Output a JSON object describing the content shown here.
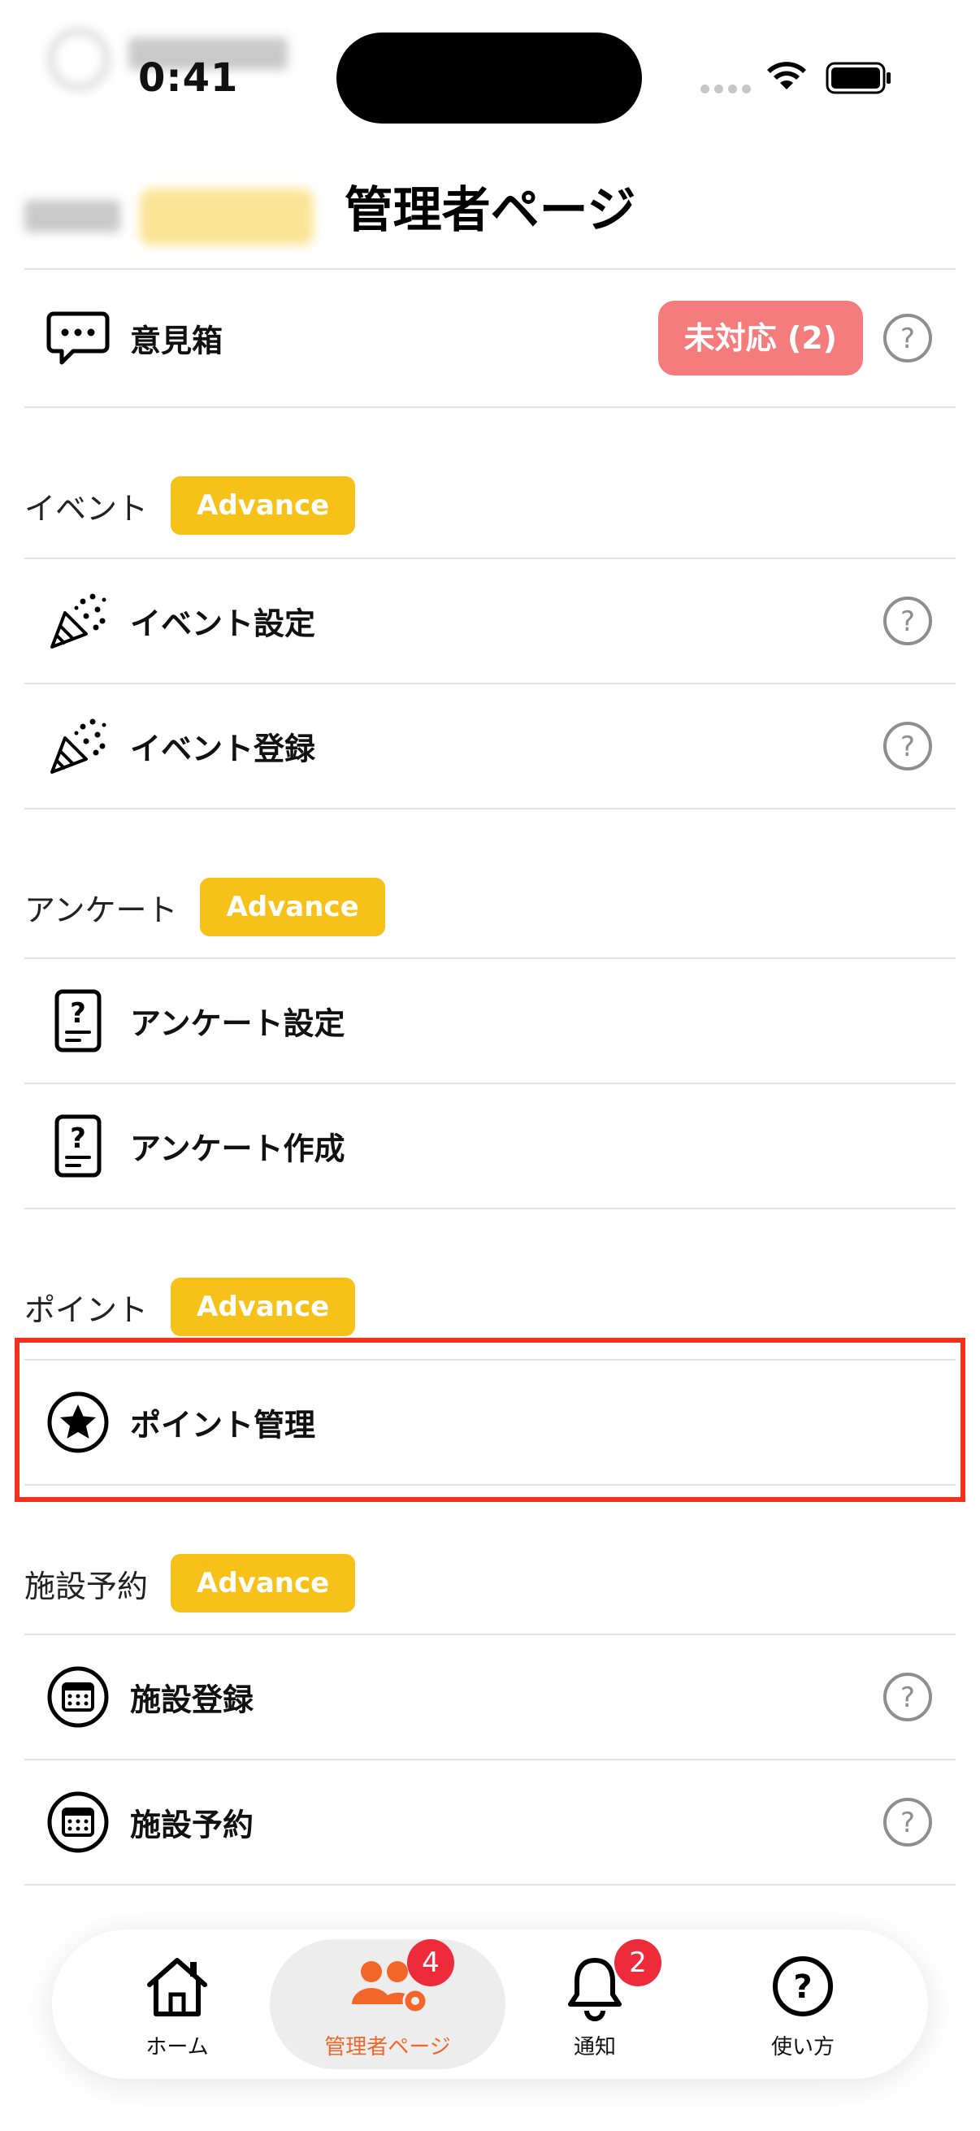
{
  "status_bar": {
    "time": "0:41"
  },
  "header": {
    "title": "管理者ページ"
  },
  "feedback_row": {
    "label": "意見箱",
    "status": "未対応 (2)"
  },
  "sections": [
    {
      "title": "イベント",
      "badge": "Advance",
      "items": [
        {
          "label": "イベント設定",
          "icon": "party-popper-icon",
          "has_help": true
        },
        {
          "label": "イベント登録",
          "icon": "party-popper-icon",
          "has_help": true
        }
      ]
    },
    {
      "title": "アンケート",
      "badge": "Advance",
      "items": [
        {
          "label": "アンケート設定",
          "icon": "survey-document-icon",
          "has_help": false
        },
        {
          "label": "アンケート作成",
          "icon": "survey-document-icon",
          "has_help": false
        }
      ]
    },
    {
      "title": "ポイント",
      "badge": "Advance",
      "items": [
        {
          "label": "ポイント管理",
          "icon": "star-circle-icon",
          "has_help": false
        }
      ]
    },
    {
      "title": "施設予約",
      "badge": "Advance",
      "items": [
        {
          "label": "施設登録",
          "icon": "calendar-icon",
          "has_help": true
        },
        {
          "label": "施設予約",
          "icon": "calendar-icon",
          "has_help": true
        }
      ]
    }
  ],
  "tabbar": {
    "items": [
      {
        "label": "ホーム",
        "icon": "home-icon"
      },
      {
        "label": "管理者ページ",
        "icon": "admin-users-icon",
        "badge": "4",
        "active": true
      },
      {
        "label": "通知",
        "icon": "bell-icon",
        "badge": "2"
      },
      {
        "label": "使い方",
        "icon": "help-icon"
      }
    ]
  },
  "colors": {
    "accent": "#f2662a",
    "advance_badge": "#f6c21a",
    "status_pill": "#f47c7c",
    "highlight": "#f2321d",
    "badge": "#ee2b3b"
  }
}
